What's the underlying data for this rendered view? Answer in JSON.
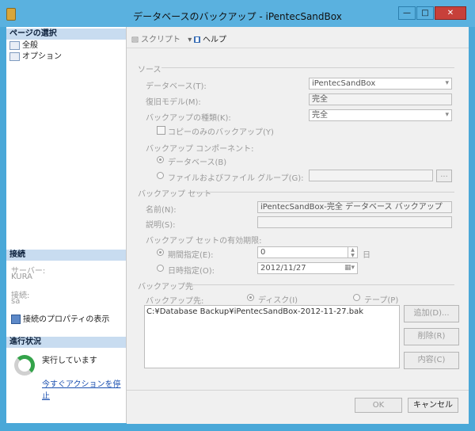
{
  "window": {
    "title": "データベースのバックアップ - iPentecSandBox",
    "controls": {
      "minimize": "—",
      "maximize": "□",
      "close": "✕"
    }
  },
  "left_panel": {
    "page_select_title": "ページの選択",
    "pages": [
      {
        "label": "全般"
      },
      {
        "label": "オプション"
      }
    ],
    "connection_title": "接続",
    "server_label": "サーバー:",
    "server_value": "KURA",
    "connect_label": "接続:",
    "connect_value": "sa",
    "properties_link": "接続のプロパティの表示",
    "progress_title": "進行状況",
    "progress_status": "実行しています",
    "stop_link": "今すぐアクションを停止"
  },
  "toolbar": {
    "script_label": "スクリプト",
    "help_label": "ヘルプ"
  },
  "form": {
    "source_group": "ソース",
    "database_label": "データベース(T):",
    "database_value": "iPentecSandBox",
    "recovery_label": "復旧モデル(M):",
    "recovery_value": "完全",
    "backup_type_label": "バックアップの種類(K):",
    "backup_type_value": "完全",
    "copy_only_label": "コピーのみのバックアップ(Y)",
    "component_label": "バックアップ コンポーネント:",
    "component_db_label": "データベース(B)",
    "component_files_label": "ファイルおよびファイル グループ(G):",
    "component_files_value": "",
    "browse_button": "...",
    "backup_set_group": "バックアップ セット",
    "name_label": "名前(N):",
    "name_value": "iPentecSandBox-完全 データベース バックアップ",
    "desc_label": "説明(S):",
    "desc_value": "",
    "expire_label": "バックアップ セットの有効期限:",
    "after_label": "期間指定(E):",
    "after_value": "0",
    "days_label": "日",
    "on_label": "日時指定(O):",
    "on_value": "2012/11/27",
    "dest_group": "バックアップ先",
    "dest_to_label": "バックアップ先:",
    "disk_label": "ディスク(I)",
    "tape_label": "テープ(P)",
    "dest_items": [
      "C:¥Database Backup¥iPentecSandBox-2012-11-27.bak"
    ],
    "add_button": "追加(D)...",
    "remove_button": "削除(R)",
    "contents_button": "内容(C)"
  },
  "footer": {
    "ok": "OK",
    "cancel": "キャンセル"
  }
}
